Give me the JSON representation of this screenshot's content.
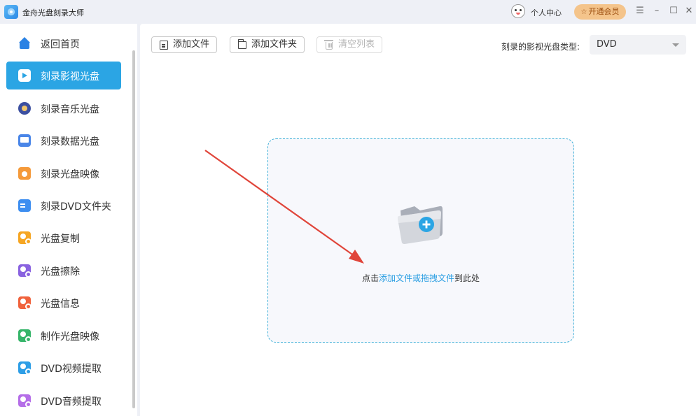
{
  "app": {
    "title": "金舟光盘刻录大师"
  },
  "header": {
    "user_center": "个人中心",
    "vip_label": "开通会员",
    "vip_icon": "☆",
    "menu_icon": "☰",
    "minimize_icon": "–",
    "maximize_icon": "☐",
    "close_icon": "✕"
  },
  "sidebar": {
    "items": [
      {
        "label": "返回首页",
        "icon": "home-icon"
      },
      {
        "label": "刻录影视光盘",
        "icon": "video-disc-icon",
        "active": true
      },
      {
        "label": "刻录音乐光盘",
        "icon": "music-disc-icon"
      },
      {
        "label": "刻录数据光盘",
        "icon": "data-disc-icon"
      },
      {
        "label": "刻录光盘映像",
        "icon": "disc-image-icon"
      },
      {
        "label": "刻录DVD文件夹",
        "icon": "dvd-folder-icon"
      },
      {
        "label": "光盘复制",
        "icon": "disc-copy-icon"
      },
      {
        "label": "光盘擦除",
        "icon": "disc-erase-icon"
      },
      {
        "label": "光盘信息",
        "icon": "disc-info-icon"
      },
      {
        "label": "制作光盘映像",
        "icon": "make-image-icon"
      },
      {
        "label": "DVD视频提取",
        "icon": "dvd-video-extract-icon"
      },
      {
        "label": "DVD音频提取",
        "icon": "dvd-audio-extract-icon"
      }
    ]
  },
  "toolbar": {
    "add_file": "添加文件",
    "add_folder": "添加文件夹",
    "clear_list": "清空列表",
    "disc_type_label": "刻录的影视光盘类型:",
    "disc_type_value": "DVD"
  },
  "dropzone": {
    "hint_prefix": "点击",
    "hint_link": "添加文件或拖拽文件",
    "hint_suffix": "到此处"
  },
  "colors": {
    "accent": "#2ba5e4",
    "link": "#2a9ee2",
    "vip_bg": "#f4c48b",
    "annotation_arrow": "#e0453a"
  }
}
